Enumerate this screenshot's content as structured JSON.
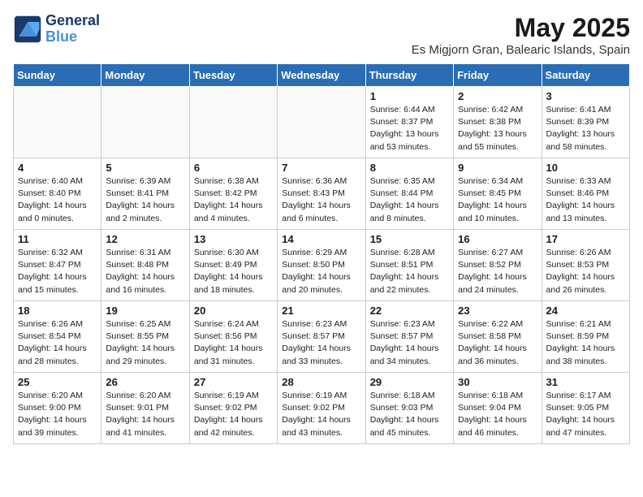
{
  "logo": {
    "text_general": "General",
    "text_blue": "Blue"
  },
  "title": "May 2025",
  "subtitle": "Es Migjorn Gran, Balearic Islands, Spain",
  "days_of_week": [
    "Sunday",
    "Monday",
    "Tuesday",
    "Wednesday",
    "Thursday",
    "Friday",
    "Saturday"
  ],
  "weeks": [
    [
      {
        "day": "",
        "info": ""
      },
      {
        "day": "",
        "info": ""
      },
      {
        "day": "",
        "info": ""
      },
      {
        "day": "",
        "info": ""
      },
      {
        "day": "1",
        "info": "Sunrise: 6:44 AM\nSunset: 8:37 PM\nDaylight: 13 hours\nand 53 minutes."
      },
      {
        "day": "2",
        "info": "Sunrise: 6:42 AM\nSunset: 8:38 PM\nDaylight: 13 hours\nand 55 minutes."
      },
      {
        "day": "3",
        "info": "Sunrise: 6:41 AM\nSunset: 8:39 PM\nDaylight: 13 hours\nand 58 minutes."
      }
    ],
    [
      {
        "day": "4",
        "info": "Sunrise: 6:40 AM\nSunset: 8:40 PM\nDaylight: 14 hours\nand 0 minutes."
      },
      {
        "day": "5",
        "info": "Sunrise: 6:39 AM\nSunset: 8:41 PM\nDaylight: 14 hours\nand 2 minutes."
      },
      {
        "day": "6",
        "info": "Sunrise: 6:38 AM\nSunset: 8:42 PM\nDaylight: 14 hours\nand 4 minutes."
      },
      {
        "day": "7",
        "info": "Sunrise: 6:36 AM\nSunset: 8:43 PM\nDaylight: 14 hours\nand 6 minutes."
      },
      {
        "day": "8",
        "info": "Sunrise: 6:35 AM\nSunset: 8:44 PM\nDaylight: 14 hours\nand 8 minutes."
      },
      {
        "day": "9",
        "info": "Sunrise: 6:34 AM\nSunset: 8:45 PM\nDaylight: 14 hours\nand 10 minutes."
      },
      {
        "day": "10",
        "info": "Sunrise: 6:33 AM\nSunset: 8:46 PM\nDaylight: 14 hours\nand 13 minutes."
      }
    ],
    [
      {
        "day": "11",
        "info": "Sunrise: 6:32 AM\nSunset: 8:47 PM\nDaylight: 14 hours\nand 15 minutes."
      },
      {
        "day": "12",
        "info": "Sunrise: 6:31 AM\nSunset: 8:48 PM\nDaylight: 14 hours\nand 16 minutes."
      },
      {
        "day": "13",
        "info": "Sunrise: 6:30 AM\nSunset: 8:49 PM\nDaylight: 14 hours\nand 18 minutes."
      },
      {
        "day": "14",
        "info": "Sunrise: 6:29 AM\nSunset: 8:50 PM\nDaylight: 14 hours\nand 20 minutes."
      },
      {
        "day": "15",
        "info": "Sunrise: 6:28 AM\nSunset: 8:51 PM\nDaylight: 14 hours\nand 22 minutes."
      },
      {
        "day": "16",
        "info": "Sunrise: 6:27 AM\nSunset: 8:52 PM\nDaylight: 14 hours\nand 24 minutes."
      },
      {
        "day": "17",
        "info": "Sunrise: 6:26 AM\nSunset: 8:53 PM\nDaylight: 14 hours\nand 26 minutes."
      }
    ],
    [
      {
        "day": "18",
        "info": "Sunrise: 6:26 AM\nSunset: 8:54 PM\nDaylight: 14 hours\nand 28 minutes."
      },
      {
        "day": "19",
        "info": "Sunrise: 6:25 AM\nSunset: 8:55 PM\nDaylight: 14 hours\nand 29 minutes."
      },
      {
        "day": "20",
        "info": "Sunrise: 6:24 AM\nSunset: 8:56 PM\nDaylight: 14 hours\nand 31 minutes."
      },
      {
        "day": "21",
        "info": "Sunrise: 6:23 AM\nSunset: 8:57 PM\nDaylight: 14 hours\nand 33 minutes."
      },
      {
        "day": "22",
        "info": "Sunrise: 6:23 AM\nSunset: 8:57 PM\nDaylight: 14 hours\nand 34 minutes."
      },
      {
        "day": "23",
        "info": "Sunrise: 6:22 AM\nSunset: 8:58 PM\nDaylight: 14 hours\nand 36 minutes."
      },
      {
        "day": "24",
        "info": "Sunrise: 6:21 AM\nSunset: 8:59 PM\nDaylight: 14 hours\nand 38 minutes."
      }
    ],
    [
      {
        "day": "25",
        "info": "Sunrise: 6:20 AM\nSunset: 9:00 PM\nDaylight: 14 hours\nand 39 minutes."
      },
      {
        "day": "26",
        "info": "Sunrise: 6:20 AM\nSunset: 9:01 PM\nDaylight: 14 hours\nand 41 minutes."
      },
      {
        "day": "27",
        "info": "Sunrise: 6:19 AM\nSunset: 9:02 PM\nDaylight: 14 hours\nand 42 minutes."
      },
      {
        "day": "28",
        "info": "Sunrise: 6:19 AM\nSunset: 9:02 PM\nDaylight: 14 hours\nand 43 minutes."
      },
      {
        "day": "29",
        "info": "Sunrise: 6:18 AM\nSunset: 9:03 PM\nDaylight: 14 hours\nand 45 minutes."
      },
      {
        "day": "30",
        "info": "Sunrise: 6:18 AM\nSunset: 9:04 PM\nDaylight: 14 hours\nand 46 minutes."
      },
      {
        "day": "31",
        "info": "Sunrise: 6:17 AM\nSunset: 9:05 PM\nDaylight: 14 hours\nand 47 minutes."
      }
    ]
  ]
}
